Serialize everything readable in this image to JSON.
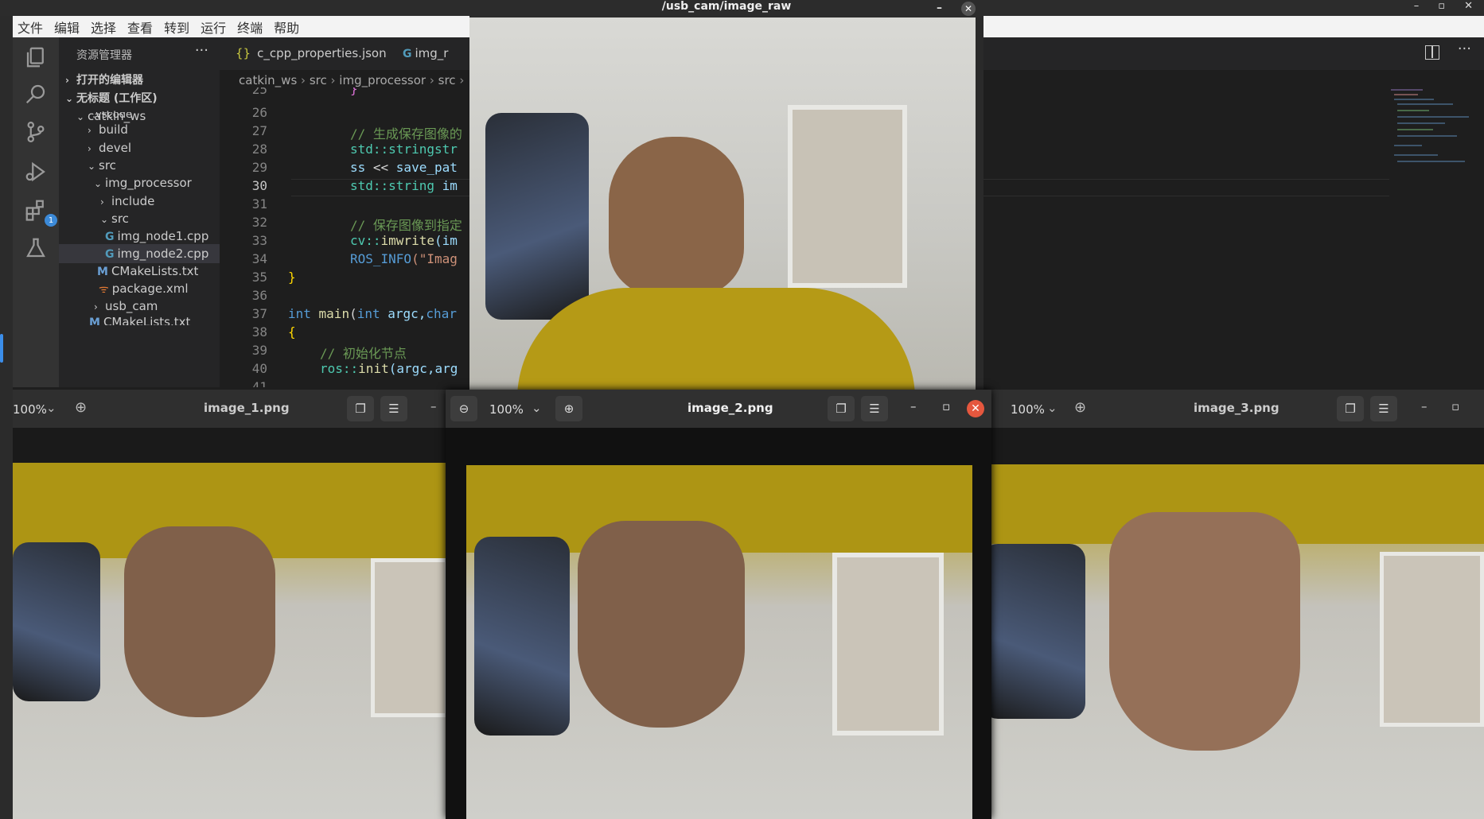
{
  "system": {
    "window_controls": [
      "–",
      "▫",
      "✕"
    ]
  },
  "menubar": {
    "items": [
      "文件",
      "编辑",
      "选择",
      "查看",
      "转到",
      "运行",
      "终端",
      "帮助"
    ]
  },
  "activity": {
    "badge": "1"
  },
  "sidebar": {
    "title": "资源管理器",
    "more": "···",
    "open_editors": "打开的编辑器",
    "workspace": "无标题 (工作区)",
    "items": [
      {
        "label": "catkin_ws",
        "chev": "⌄"
      },
      {
        "label": ".vscode",
        "chev": ""
      },
      {
        "label": "build",
        "chev": "›"
      },
      {
        "label": "devel",
        "chev": "›"
      },
      {
        "label": "src",
        "chev": "⌄"
      },
      {
        "label": "img_processor",
        "chev": "⌄"
      },
      {
        "label": "include",
        "chev": "›"
      },
      {
        "label": "src",
        "chev": "⌄"
      },
      {
        "label": "img_node1.cpp",
        "icon": "G"
      },
      {
        "label": "img_node2.cpp",
        "icon": "G"
      },
      {
        "label": "CMakeLists.txt",
        "icon": "M"
      },
      {
        "label": "package.xml",
        "icon": "rss"
      },
      {
        "label": "usb_cam",
        "chev": "›"
      },
      {
        "label": "CMakeLists.txt",
        "icon": "M"
      }
    ]
  },
  "tabs": [
    {
      "label": "c_cpp_properties.json",
      "icon": "{}"
    },
    {
      "label": "img_r",
      "icon": "G"
    }
  ],
  "breadcrumb": [
    "catkin_ws",
    "src",
    "img_processor",
    "src"
  ],
  "gutter": [
    "25",
    "26",
    "27",
    "28",
    "29",
    "30",
    "31",
    "32",
    "33",
    "34",
    "35",
    "36",
    "37",
    "38",
    "39",
    "40",
    "41"
  ],
  "code": {
    "l25": "}",
    "l27": "// 生成保存图像的",
    "l28a": "std::",
    "l28b": "stringstr",
    "l29a": "ss",
    "l29b": " << ",
    "l29c": "save_pat",
    "l30a": "std::",
    "l30b": "string",
    "l30c": " im",
    "l32": "// 保存图像到指定",
    "l33a": "cv::",
    "l33b": "imwrite",
    "l33c": "(im",
    "l34a": "ROS_INFO",
    "l34b": "(\"Imag",
    "l35": "}",
    "l37a": "int",
    "l37b": " main",
    "l37c": "(",
    "l37d": "int",
    "l37e": " argc,",
    "l37f": "char",
    "l38": "{",
    "l39": "// 初始化节点",
    "l40a": "ros::",
    "l40b": "init",
    "l40c": "(argc,arg"
  },
  "camera_window": {
    "title": "/usb_cam/image_raw"
  },
  "viewer1": {
    "title": "image_1.png",
    "zoom": "100%"
  },
  "viewer2": {
    "title": "image_2.png",
    "zoom": "100%"
  },
  "viewer3": {
    "title": "image_3.png",
    "zoom": "100%"
  }
}
